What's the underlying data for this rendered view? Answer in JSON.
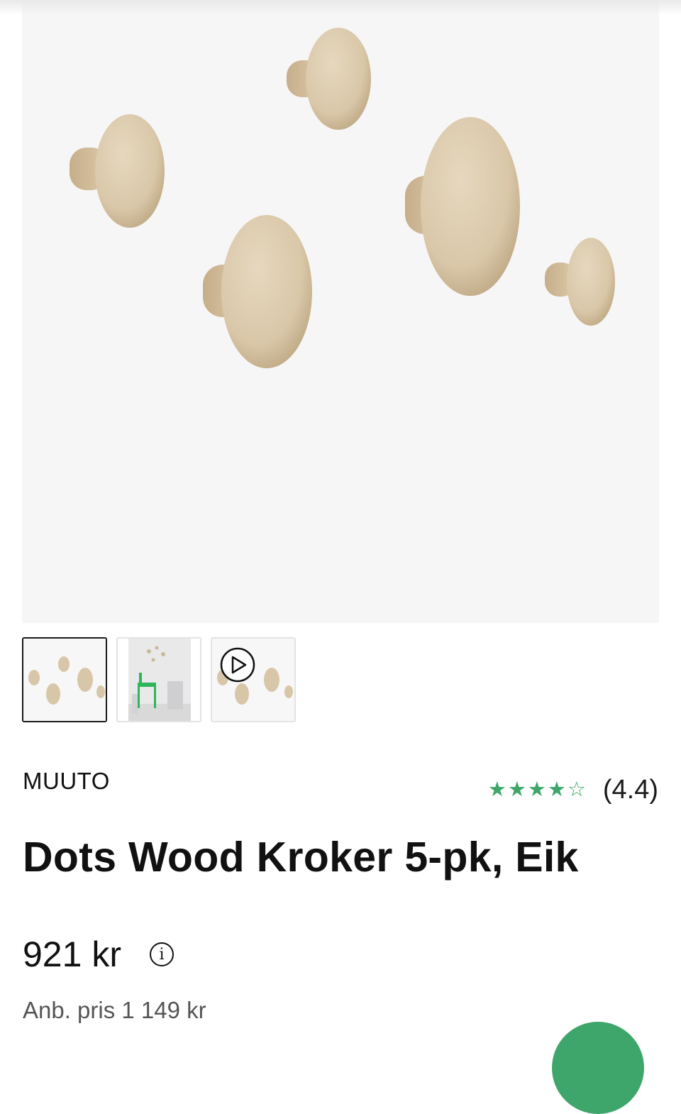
{
  "product": {
    "brand": "MUUTO",
    "title": "Dots Wood Kroker 5-pk, Eik",
    "price": "921 kr",
    "old_price": "Anb. pris 1 149 kr",
    "rating": {
      "value": 4.4,
      "label": "(4.4)",
      "max": 5
    },
    "info_icon_glyph": "i"
  },
  "gallery": {
    "thumbnails": [
      {
        "name": "thumb-product",
        "active": true
      },
      {
        "name": "thumb-room"
      },
      {
        "name": "thumb-video",
        "icon": "play-icon"
      }
    ]
  },
  "colors": {
    "accent_green": "#3ea66b",
    "hero_bg": "#f6f6f6",
    "wood": "#d8c6a8"
  }
}
